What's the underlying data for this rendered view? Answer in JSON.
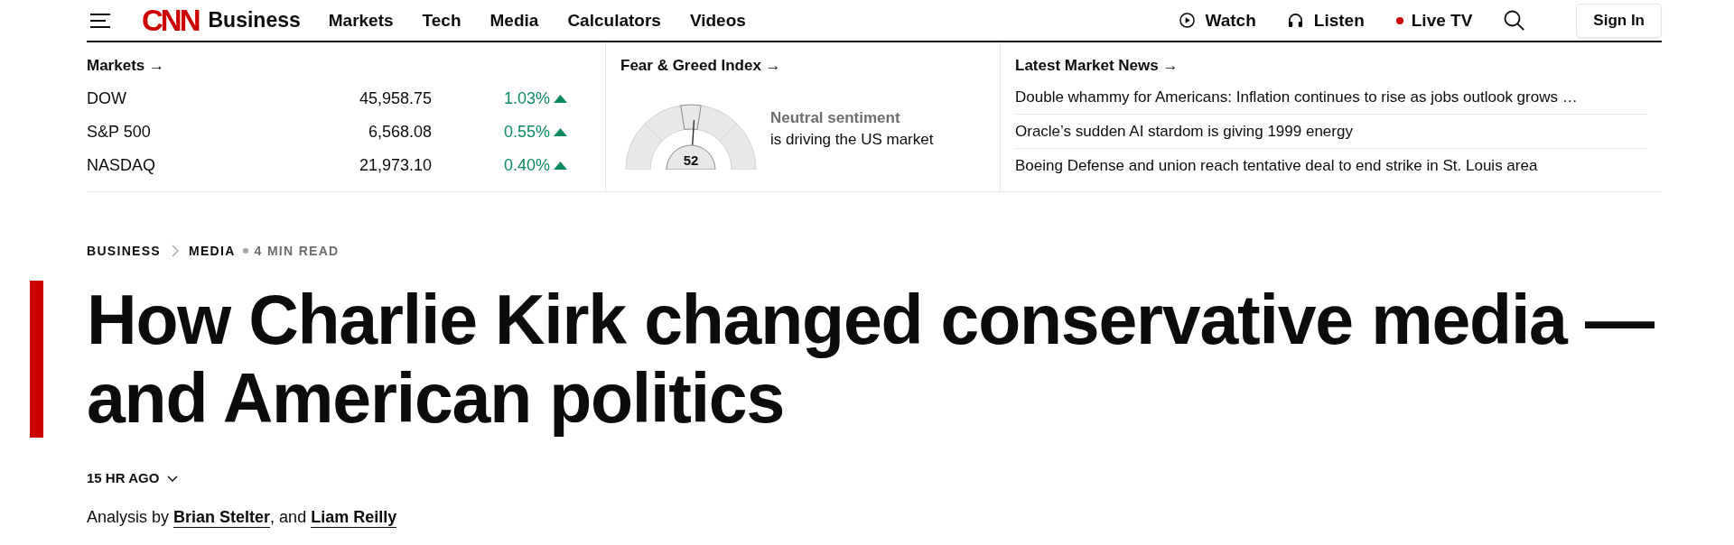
{
  "header": {
    "logo": "CNN",
    "section": "Business",
    "nav": [
      {
        "label": "Markets"
      },
      {
        "label": "Tech"
      },
      {
        "label": "Media"
      },
      {
        "label": "Calculators"
      },
      {
        "label": "Videos"
      }
    ],
    "actions": [
      {
        "kind": "watch",
        "label": "Watch"
      },
      {
        "kind": "listen",
        "label": "Listen"
      },
      {
        "kind": "live",
        "label": "Live TV"
      },
      {
        "kind": "search"
      }
    ],
    "sign_in": "Sign In"
  },
  "markets": {
    "title": "Markets →",
    "rows": [
      {
        "name": "DOW",
        "value": "45,958.75",
        "change": "1.03%",
        "up": true
      },
      {
        "name": "S&P 500",
        "value": "6,568.08",
        "change": "0.55%",
        "up": true
      },
      {
        "name": "NASDAQ",
        "value": "21,973.10",
        "change": "0.40%",
        "up": true
      }
    ]
  },
  "fear_greed": {
    "title": "Fear & Greed Index →",
    "gauge": {
      "value": "52",
      "level": 0.52
    },
    "sentiment": "Neutral sentiment",
    "caption": "is driving the US market"
  },
  "market_news": {
    "title": "Latest Market News →",
    "items": [
      "Double whammy for Americans: Inflation continues to rise as jobs outlook grows …",
      "Oracle’s sudden AI stardom is giving 1999 energy",
      "Boeing Defense and union reach tentative deal to end strike in St. Louis area"
    ]
  },
  "article": {
    "breadcrumb": [
      "BUSINESS",
      "MEDIA"
    ],
    "read_time": "4 MIN READ",
    "headline": "How Charlie Kirk changed conservative media — and American politics",
    "timestamp": {
      "label": "15 HR AGO",
      "expanded": false
    },
    "byline": {
      "prefix": "Analysis by",
      "authors": [
        "Brian Stelter",
        "Liam Reilly"
      ],
      "joiner": ", and"
    }
  }
}
